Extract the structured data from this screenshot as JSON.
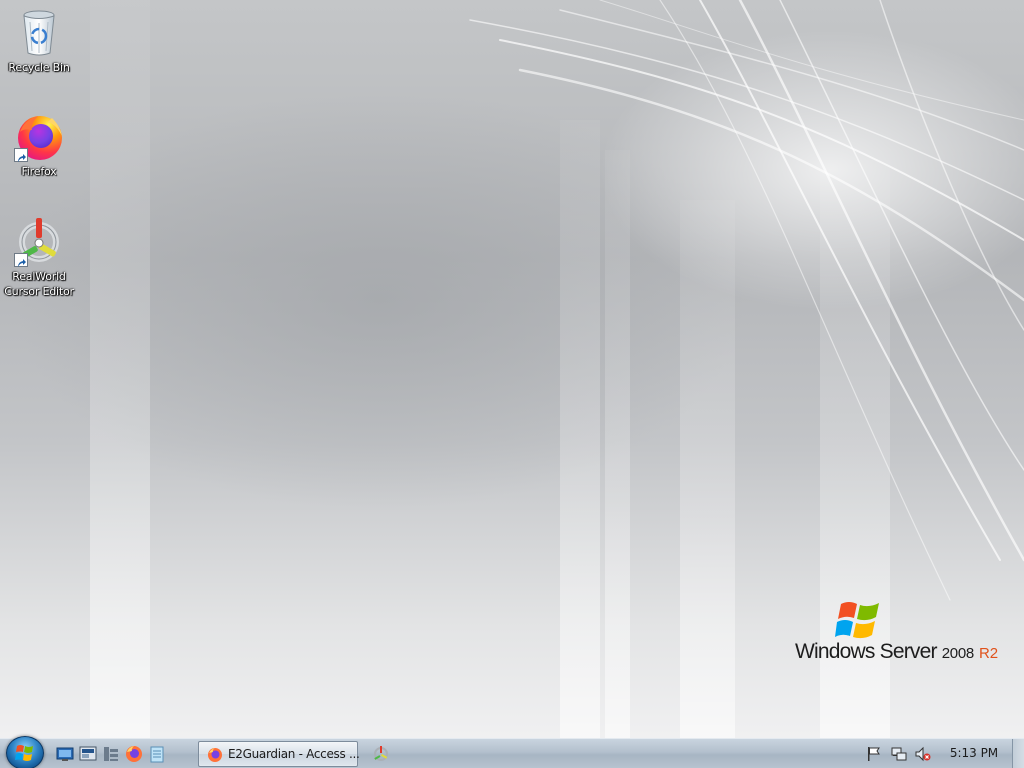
{
  "desktop": {
    "icons": [
      {
        "label": "Recycle Bin",
        "icon": "recycle-bin-icon"
      },
      {
        "label": "Firefox",
        "icon": "firefox-icon"
      },
      {
        "label": "RealWorld Cursor Editor",
        "label_line1": "RealWorld",
        "label_line2": "Cursor Editor",
        "icon": "realworld-cursor-editor-icon"
      }
    ],
    "branding": {
      "windows": "Windows Server",
      "year": "2008",
      "edition": "R2"
    }
  },
  "taskbar": {
    "start_icon": "windows-orb-icon",
    "quick_launch": [
      "show-desktop-icon",
      "server-manager-icon",
      "file-explorer-icon",
      "firefox-icon",
      "notepad-icon"
    ],
    "task_buttons": [
      {
        "label": "E2Guardian - Access ...",
        "icon": "firefox-icon"
      }
    ],
    "pinned_after_tasks": [
      "realworld-cursor-editor-icon"
    ],
    "tray": [
      "action-center-flag-icon",
      "network-icon",
      "volume-muted-icon"
    ],
    "clock": "5:13 PM"
  },
  "colors": {
    "taskbar": "#b3c0cd",
    "brand_accent": "#e0521b"
  }
}
